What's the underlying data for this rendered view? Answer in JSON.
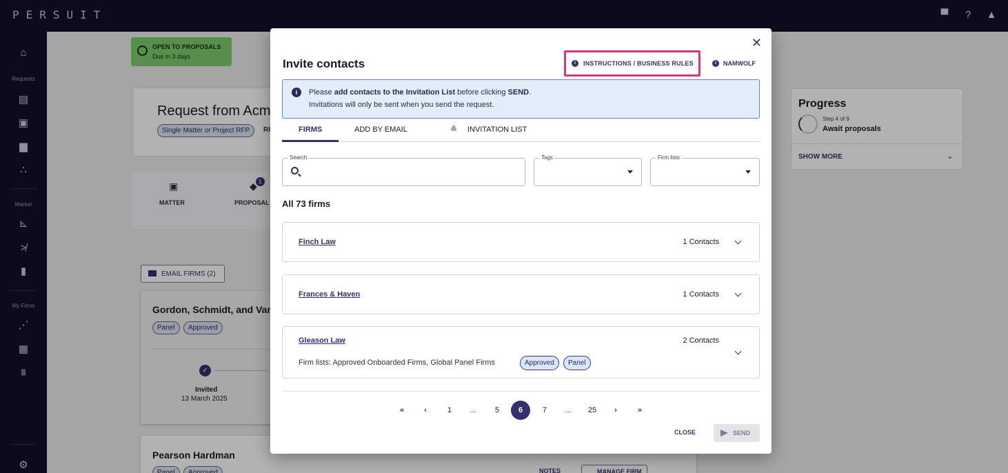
{
  "app": {
    "logo": "PERSUIT",
    "top_icons": [
      "chat-icon",
      "help-icon",
      "bell-icon"
    ]
  },
  "rail": {
    "sections": [
      "Requests",
      "Market",
      "My Firms"
    ],
    "icons": [
      "home-icon",
      "new-request-icon",
      "invoice-icon",
      "document-icon",
      "nodes-icon",
      "chart-line-icon",
      "trend-off-icon",
      "bar-chart-icon",
      "sparkline-icon",
      "firm-card-icon",
      "team-icon",
      "gear-icon"
    ]
  },
  "background": {
    "status_title": "OPEN TO PROPOSALS",
    "status_due": "Due in 3 days",
    "request_title": "Request from Acm",
    "request_chip": "Single Matter or Project RFP",
    "request_chip_extra": "RI",
    "tabs": [
      {
        "label": "MATTER"
      },
      {
        "label": "PROPOSAL",
        "badge": "1"
      }
    ],
    "email_firms": "EMAIL FIRMS (2)",
    "firm1": {
      "name": "Gordon, Schmidt, and Van",
      "chips": [
        "Panel",
        "Approved"
      ],
      "stage": "Invited",
      "date": "13 March 2025"
    },
    "firm2": {
      "name": "Pearson Hardman",
      "chips": [
        "Panel",
        "Approved"
      ],
      "notes": "NOTES",
      "manage": "MANAGE FIRM"
    },
    "progress": {
      "title": "Progress",
      "step": "Step 4 of 9",
      "stage": "Await proposals",
      "show_more": "SHOW MORE"
    }
  },
  "modal": {
    "title": "Invite contacts",
    "instructions_button": "INSTRUCTIONS / BUSINESS RULES",
    "namwolf_button": "NAMWOLF",
    "info": {
      "pre": "Please ",
      "bold1": "add contacts to the Invitation List",
      "mid": " before clicking ",
      "bold2": "SEND",
      "end": ".",
      "line2": "Invitations will only be sent when you send the request."
    },
    "tabs": [
      {
        "label": "FIRMS",
        "active": true
      },
      {
        "label": "ADD BY EMAIL",
        "active": false
      },
      {
        "label": "INVITATION LIST",
        "active": false
      }
    ],
    "filters": {
      "search_label": "Search",
      "search_value": "",
      "tags_label": "Tags",
      "tags_value": "",
      "firm_lists_label": "Firm lists",
      "firm_lists_value": ""
    },
    "all_firms": "All 73 firms",
    "firms": [
      {
        "name": "Finch Law",
        "contacts": "1 Contacts"
      },
      {
        "name": "Frances & Haven",
        "contacts": "1 Contacts"
      },
      {
        "name": "Gleason Law",
        "contacts": "2 Contacts",
        "firm_lists": "Firm lists:  Approved Onboarded Firms,  Global Panel Firms",
        "tags": [
          "Approved",
          "Panel"
        ]
      }
    ],
    "pagination": {
      "first": "«",
      "prev": "‹",
      "pages": [
        "1",
        "...",
        "5",
        "6",
        "7",
        "...",
        "25"
      ],
      "current": "6",
      "next": "›",
      "last": "»"
    },
    "close_button": "CLOSE",
    "send_button": "SEND"
  }
}
